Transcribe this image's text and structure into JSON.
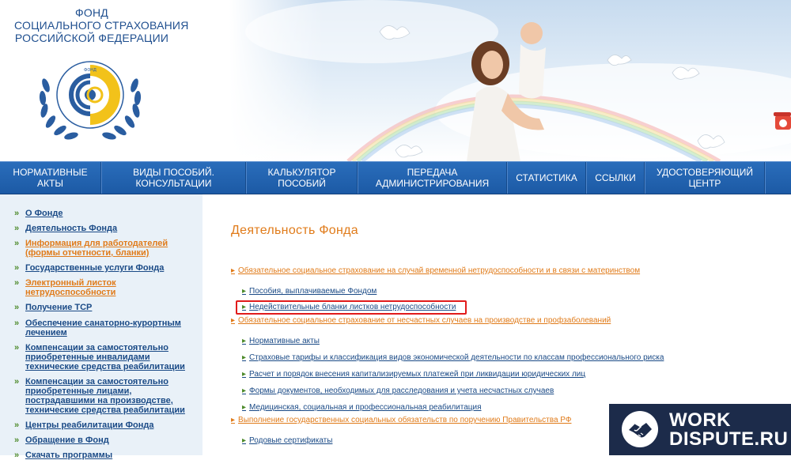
{
  "header": {
    "org_title": [
      "ФОНД",
      "СОЦИАЛЬНОГО СТРАХОВАНИЯ",
      "РОССИЙСКОЙ ФЕДЕРАЦИИ"
    ],
    "emblem_text": "ФОНД СОЦИАЛЬНОГО СТРАХОВАНИЯ РОССИЙСКАЯ ФЕДЕРАЦИЯ"
  },
  "nav": {
    "items": [
      [
        "НОРМАТИВНЫЕ",
        "АКТЫ"
      ],
      [
        "ВИДЫ ПОСОБИЙ.",
        "КОНСУЛЬТАЦИИ"
      ],
      [
        "КАЛЬКУЛЯТОР",
        "ПОСОБИЙ"
      ],
      [
        "ПЕРЕДАЧА",
        "АДМИНИСТРИРОВАНИЯ"
      ],
      [
        "СТАТИСТИКА"
      ],
      [
        "ССЫЛКИ"
      ],
      [
        "УДОСТОВЕРЯЮЩИЙ",
        "ЦЕНТР"
      ]
    ]
  },
  "sidebar": {
    "items": [
      {
        "label": "О Фонде",
        "active": false
      },
      {
        "label": "Деятельность Фонда",
        "active": false
      },
      {
        "label": "Информация для работодателей (формы отчетности, бланки)",
        "active": true
      },
      {
        "label": "Государственные услуги Фонда",
        "active": false
      },
      {
        "label": "Электронный листок нетрудоспособности",
        "active": true
      },
      {
        "label": "Получение ТСР",
        "active": false
      },
      {
        "label": "Обеспечение санаторно-курортным лечением",
        "active": false
      },
      {
        "label": "Компенсации за самостоятельно приобретенные инвалидами технические средства реабилитации",
        "active": false
      },
      {
        "label": "Компенсации за самостоятельно приобретенные лицами, пострадавшими на производстве, технические средства реабилитации",
        "active": false
      },
      {
        "label": "Центры реабилитации Фонда",
        "active": false
      },
      {
        "label": "Обращение в Фонд",
        "active": false
      },
      {
        "label": "Скачать программы",
        "active": false
      }
    ]
  },
  "content": {
    "title": "Деятельность Фонда",
    "sections": [
      {
        "label": "Обязательное социальное страхование на случай временной нетрудоспособности и в связи с материнством",
        "links": [
          "Пособия, выплачиваемые Фондом",
          "Недействительные бланки листков нетрудоспособности"
        ]
      },
      {
        "label": "Обязательное социальное страхование от несчастных случаев на производстве и профзаболеваний",
        "links": [
          "Нормативные акты",
          "Страховые тарифы и классификация видов экономической деятельности по классам профессионального риска",
          "Расчет и порядок внесения капитализируемых платежей при ликвидации юридических лиц",
          "Формы документов, необходимых для расследования и учета несчастных случаев",
          "Медицинская, социальная и профессиональная реабилитация"
        ]
      },
      {
        "label": "Выполнение государственных социальных обязательств по поручению Правительства РФ",
        "links": [
          "Родовые сертификаты"
        ]
      }
    ],
    "highlighted_link": "Недействительные бланки листков нетрудоспособности"
  },
  "watermark": {
    "line1": "WORK",
    "line2": "DISPUTE.RU"
  },
  "colors": {
    "nav_blue": "#1f62b0",
    "orange": "#e07b1a",
    "link_blue": "#1a4a86",
    "bullet_green": "#4d8a2a",
    "highlight_red": "#e11b1b"
  },
  "icons": [
    "emblem-icon",
    "phone-icon",
    "bullet-icon",
    "handshake-icon"
  ]
}
